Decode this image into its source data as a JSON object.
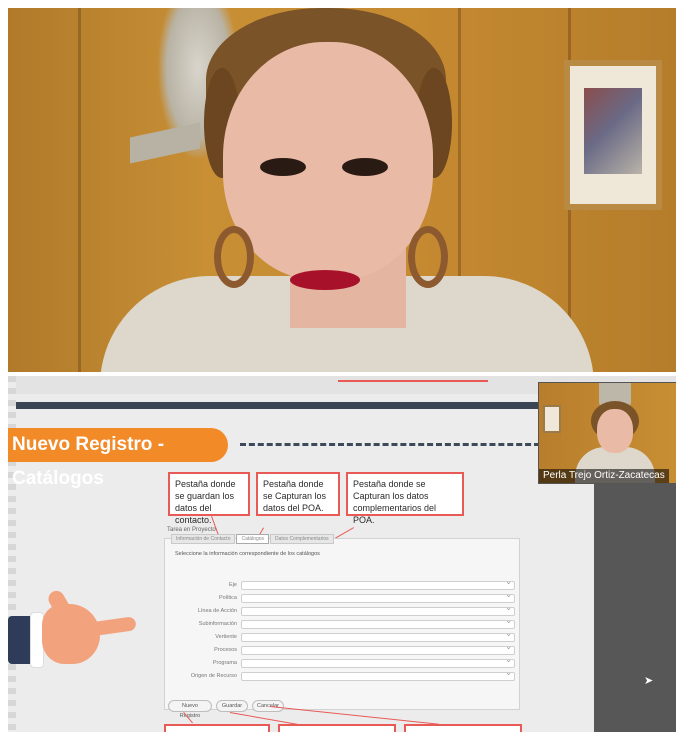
{
  "slide": {
    "title": "Nuevo Registro - Catálogos",
    "callouts": [
      "Pestaña donde se guardan los datos del contacto.",
      "Pestaña donde se Capturan los datos del POA.",
      "Pestaña donde se Capturan los datos complementarios del POA."
    ]
  },
  "form": {
    "header": "Tarea en Proyecto",
    "tabs": [
      "Información de Contacto",
      "Catálogos",
      "Datos Complementarios"
    ],
    "instructions": "Seleccione la información correspondiente de los catálogos",
    "fields": [
      "Eje",
      "Política",
      "Línea de Acción",
      "Subinformación",
      "Vertiente",
      "Procesos",
      "Programa",
      "Origen de Recurso"
    ],
    "buttons": [
      "Nuevo Registro",
      "Guardar",
      "Cancelar"
    ]
  },
  "participant": {
    "name": "Perla Trejo Ortiz-Zacatecas"
  },
  "colors": {
    "accent_orange": "#f28a28",
    "callout_red": "#e85a55",
    "dark_bar": "#3b4655"
  }
}
